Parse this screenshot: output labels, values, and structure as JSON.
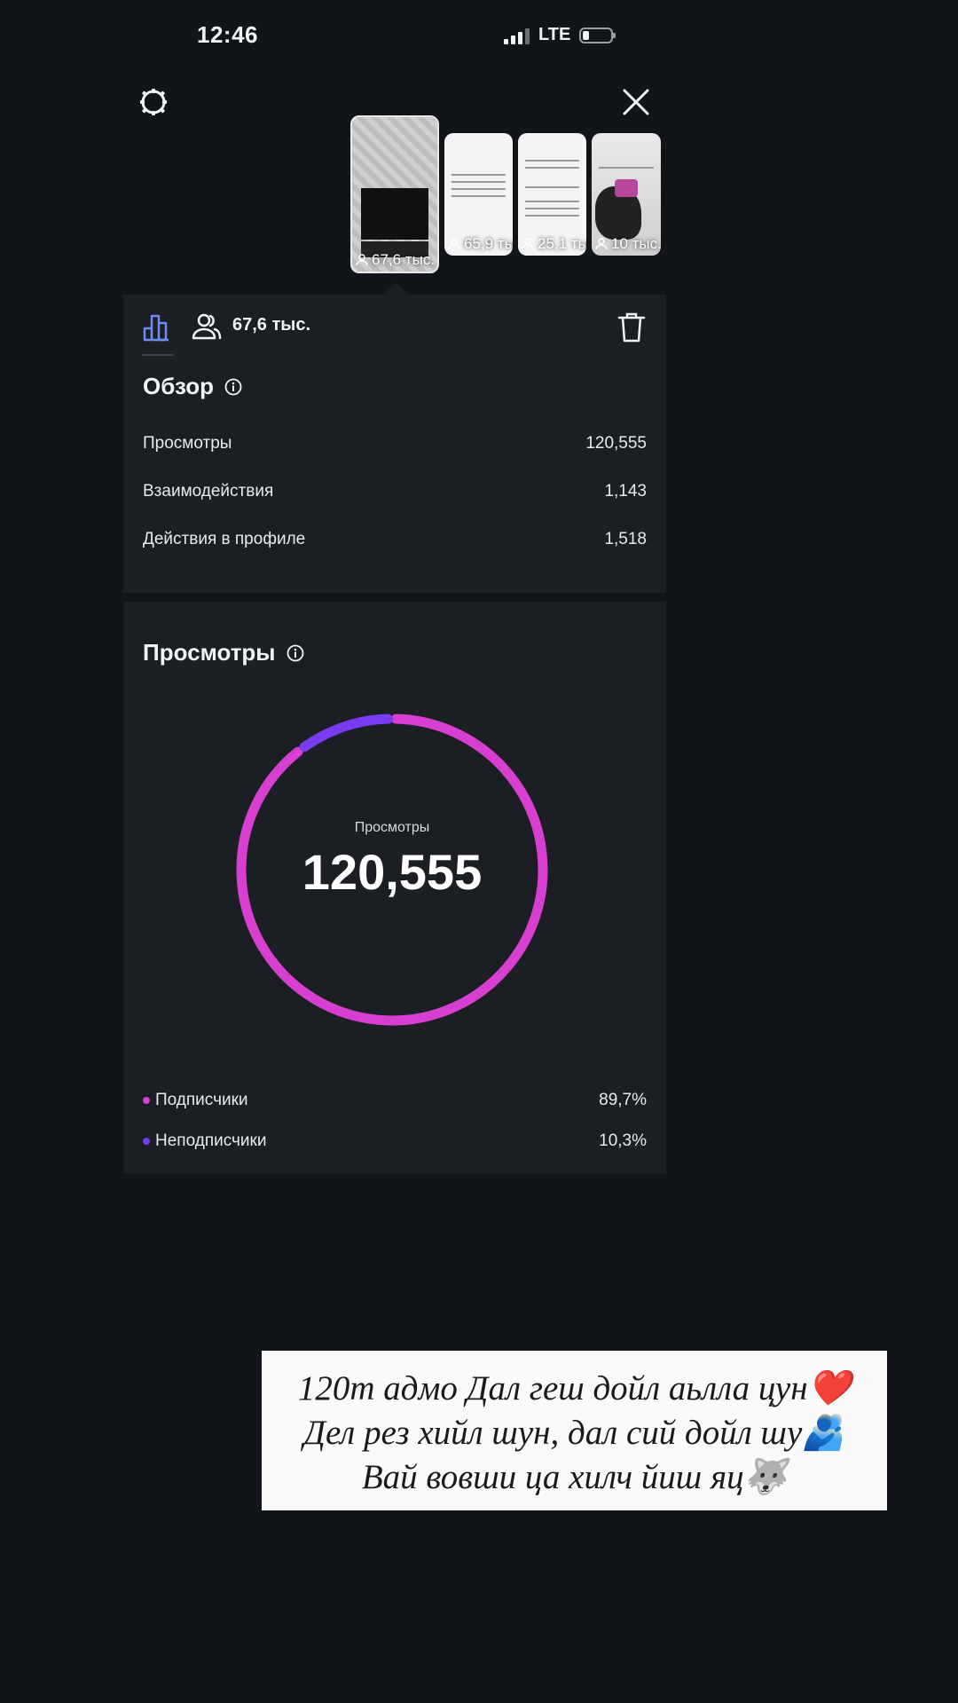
{
  "status_bar": {
    "time": "12:46",
    "network": "LTE"
  },
  "header": {
    "settings_icon": "settings-gear-icon",
    "close_icon": "close-icon"
  },
  "stories": [
    {
      "views": "67,6 тыс.",
      "selected": true
    },
    {
      "views": "65,9 тыс."
    },
    {
      "views": "25,1 тыс."
    },
    {
      "views": "10 тыс."
    }
  ],
  "tabs": {
    "people_count": "67,6 тыс."
  },
  "overview": {
    "title": "Обзор",
    "rows": [
      {
        "label": "Просмотры",
        "value": "120,555"
      },
      {
        "label": "Взаимодействия",
        "value": "1,143"
      },
      {
        "label": "Действия в профиле",
        "value": "1,518"
      }
    ]
  },
  "views_section": {
    "title": "Просмотры",
    "center_label": "Просмотры",
    "center_value": "120,555",
    "legend": [
      {
        "label": "Подписчики",
        "value": "89,7%",
        "color": "#d63fd0"
      },
      {
        "label": "Неподписчики",
        "value": "10,3%",
        "color": "#7a3cf0"
      }
    ]
  },
  "chart_data": {
    "type": "pie",
    "categories": [
      "Подписчики",
      "Неподписчики"
    ],
    "values": [
      89.7,
      10.3
    ],
    "colors": [
      "#d63fd0",
      "#7a3cf0"
    ],
    "center_label": "Просмотры",
    "center_value": "120,555"
  },
  "caption": {
    "line1": "120т  адмо Дал геш дойл аьлла цун❤️",
    "line2": "Дел рез хийл шун, дал сий дойл шу🫂",
    "line3": "Вай вовши ца хилч йиш яц🐺"
  }
}
